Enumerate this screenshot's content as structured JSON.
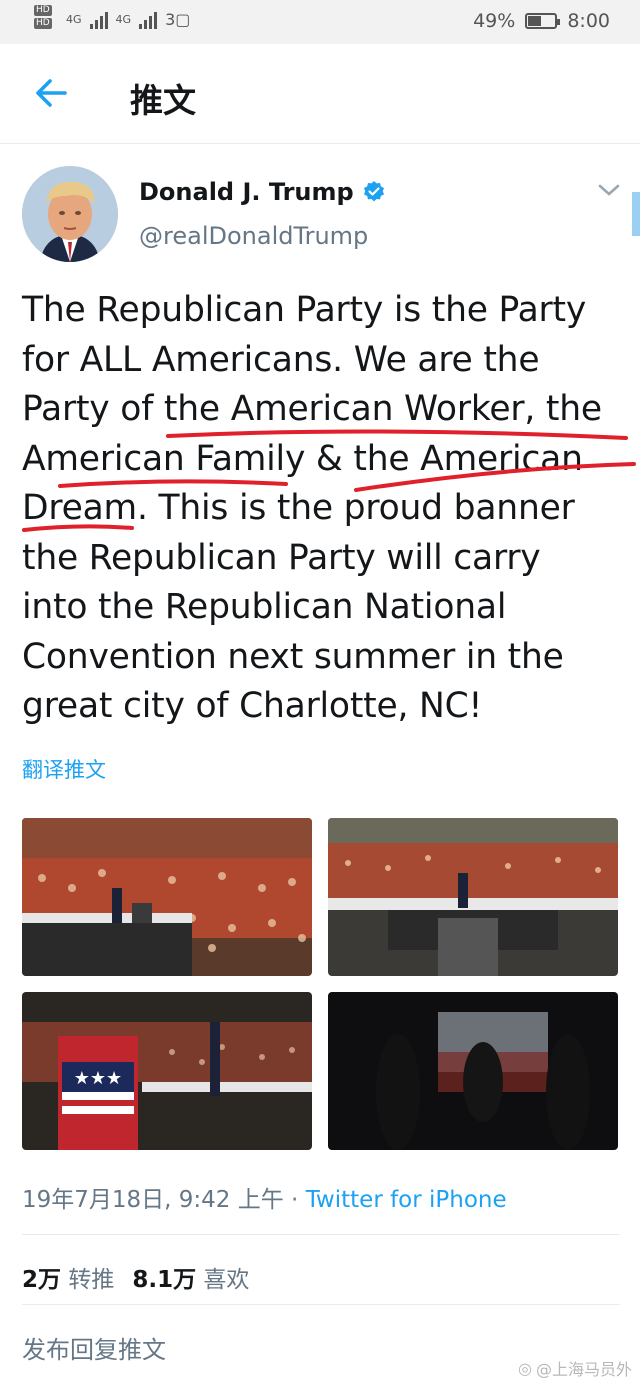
{
  "status_bar": {
    "hd1": "HD",
    "hd2": "HD",
    "net1": "4G",
    "net2": "4G",
    "battery_pct_text": "49%",
    "battery_level": 0.49,
    "time": "8:00"
  },
  "header": {
    "back_icon": "back-arrow-icon",
    "title": "推文"
  },
  "tweet": {
    "author_name": "Donald J. Trump",
    "handle": "@realDonaldTrump",
    "verified_icon": "verified-badge-icon",
    "text_lines": [
      "The Republican Party is the Party",
      "for ALL Americans. We are the",
      "Party of the American Worker, the",
      "American Family & the American",
      "Dream. This is the proud banner",
      "the Republican Party will carry",
      "into the Republican National",
      "Convention next summer in the",
      "great city of Charlotte, NC!"
    ],
    "translate_label": "翻译推文",
    "timestamp": "19年7月18日, 9:42 上午 · ",
    "source": "Twitter for iPhone",
    "retweet_count": "2万",
    "retweet_label": "转推",
    "like_count": "8.1万",
    "like_label": "喜欢",
    "reply_placeholder": "发布回复推文"
  },
  "watermark": "@上海马员外",
  "colors": {
    "accent": "#1da1f2",
    "text": "#14171a",
    "secondary": "#657786",
    "scribble": "#e0202a"
  }
}
